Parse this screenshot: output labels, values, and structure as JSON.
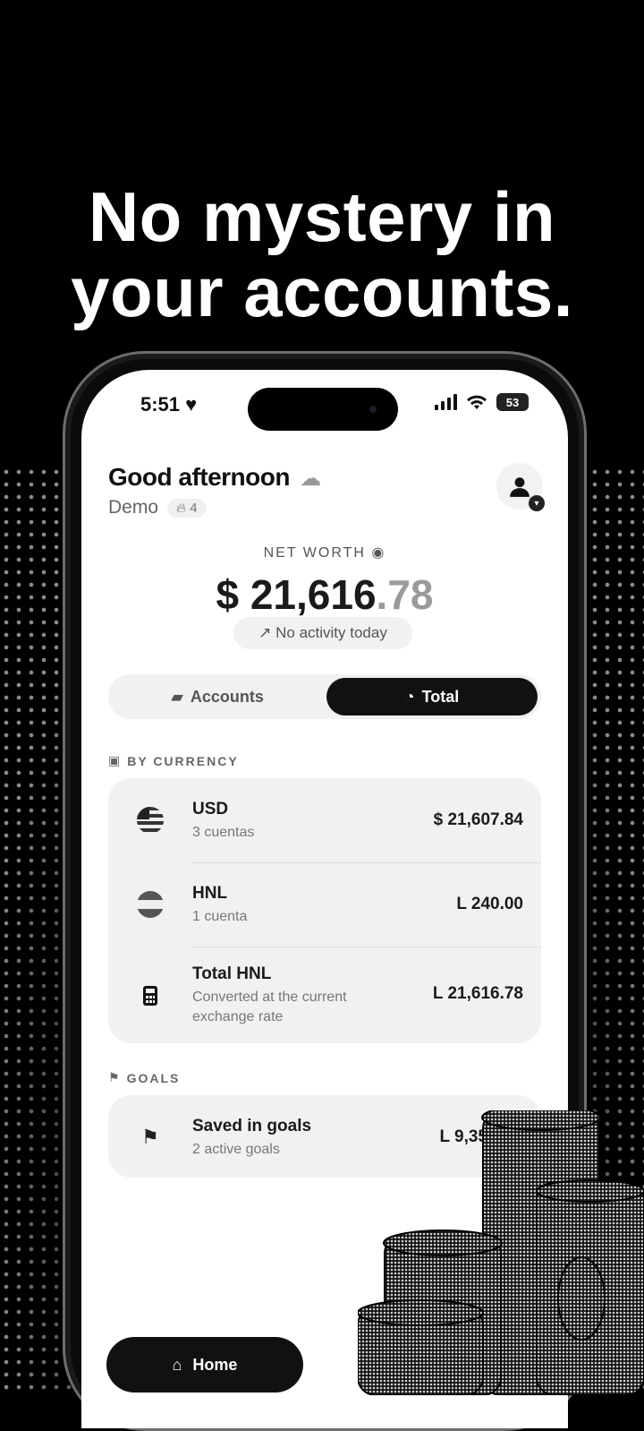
{
  "headline": {
    "line1": "No mystery in",
    "line2": "your accounts."
  },
  "status_bar": {
    "time": "5:51",
    "battery": "53"
  },
  "header": {
    "greeting": "Good afternoon",
    "user": "Demo",
    "streak": "4"
  },
  "net_worth": {
    "label": "NET WORTH",
    "value_main": "$ 21,616",
    "value_cents": ".78",
    "activity": "No activity today"
  },
  "view_toggle": {
    "accounts_label": "Accounts",
    "total_label": "Total",
    "selected": "Total"
  },
  "by_currency": {
    "title": "BY CURRENCY",
    "rows": [
      {
        "name": "USD",
        "sub": "3 cuentas",
        "amount": "$ 21,607.84",
        "icon": "us-flag-icon"
      },
      {
        "name": "HNL",
        "sub": "1 cuenta",
        "amount": "L 240.00",
        "icon": "honduras-flag-icon"
      },
      {
        "name": "Total HNL",
        "sub": "Converted at the current exchange rate",
        "amount": "L 21,616.78",
        "icon": "calculator-icon"
      }
    ]
  },
  "goals": {
    "title": "GOALS",
    "rows": [
      {
        "name": "Saved in goals",
        "sub": "2 active goals",
        "amount": "L 9,35",
        "icon": "flag-icon"
      }
    ]
  },
  "tab_bar": {
    "home_label": "Home"
  },
  "colors": {
    "background": "#000000",
    "screen": "#ffffff",
    "accent": "#111111",
    "card": "#f1f1f1"
  }
}
